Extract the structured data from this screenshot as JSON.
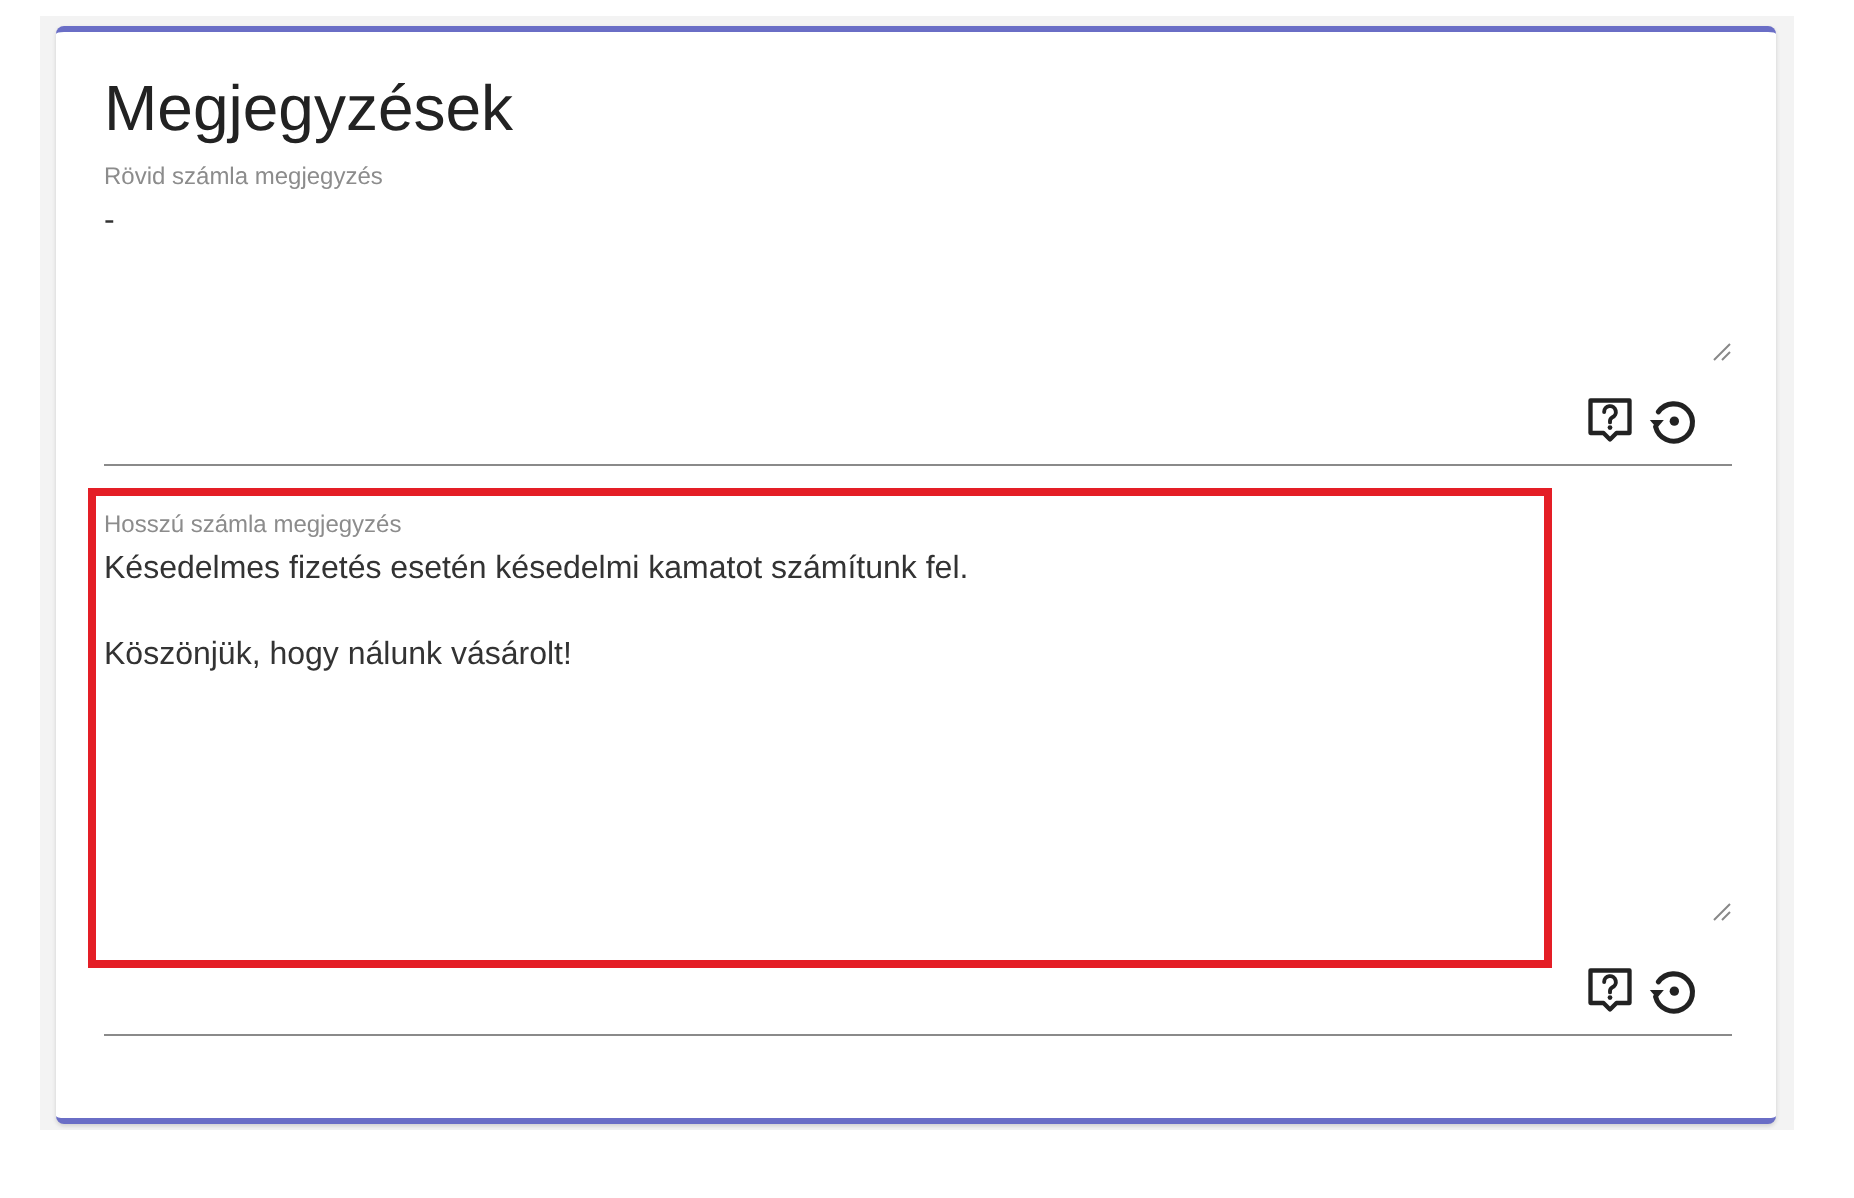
{
  "card": {
    "title": "Megjegyzések"
  },
  "fields": [
    {
      "label": "Rövid számla megjegyzés",
      "paragraphs": [
        "-"
      ],
      "highlighted": false
    },
    {
      "label": "Hosszú számla megjegyzés",
      "paragraphs": [
        "Késedelmes fizetés esetén késedelmi kamatot számítunk fel.",
        "Köszönjük, hogy nálunk vásárolt!"
      ],
      "highlighted": true
    }
  ]
}
